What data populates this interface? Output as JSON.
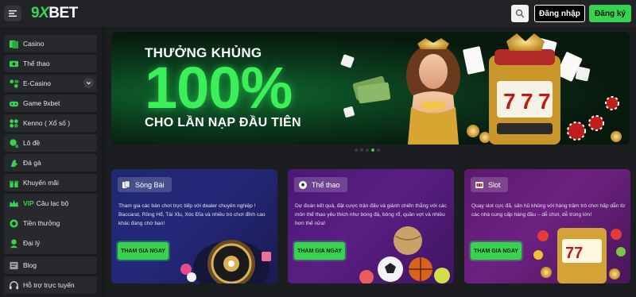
{
  "header": {
    "logo_nine": "9",
    "logo_x": "X",
    "logo_bet": "BET",
    "login_label": "Đăng nhập",
    "register_label": "Đăng ký"
  },
  "sidebar": {
    "items": [
      {
        "label": "Casino",
        "icon": "casino-icon"
      },
      {
        "label": "Thể thao",
        "icon": "sports-icon"
      },
      {
        "label": "E-Casino",
        "icon": "ecasino-icon"
      },
      {
        "label": "Game 9xbet",
        "icon": "gamepad-icon"
      },
      {
        "label": "Kenno ( Xổ số )",
        "icon": "lottery-icon"
      },
      {
        "label": "Lô đề",
        "icon": "lode-icon"
      },
      {
        "label": "Đá gà",
        "icon": "rooster-icon"
      },
      {
        "label": "Khuyến mãi",
        "icon": "gift-icon"
      },
      {
        "label_vip": "VIP",
        "label": "Câu lạc bộ",
        "icon": "crown-icon"
      },
      {
        "label": "Tiền thưởng",
        "icon": "reward-icon"
      },
      {
        "label": "Đại lý",
        "icon": "agent-icon"
      },
      {
        "label": "Blog",
        "icon": "blog-icon"
      },
      {
        "label": "Hỗ trợ trực tuyến",
        "icon": "headset-icon"
      }
    ]
  },
  "banner": {
    "line1": "THƯỞNG KHỦNG",
    "line2": "100%",
    "line3": "CHO LẦN NẠP ĐẦU TIÊN",
    "slide_count": 5,
    "active_slide": 4
  },
  "cards": [
    {
      "title": "Sòng Bài",
      "icon": "cards-icon",
      "description": "Tham gia các bàn chơi trực tiếp với dealer chuyên nghiệp ! Baccarat, Rồng Hổ, Tài Xỉu, Xóc Đĩa và nhiều trò chơi đỉnh cao khác đang chờ bạn!",
      "button": "THAM GIA NGAY"
    },
    {
      "title": "Thể thao",
      "icon": "soccer-ball-icon",
      "description": "Dự đoán kết quả, đặt cược trận đấu và giành chiến thắng với các môn thể thao yêu thích như bóng đá, bóng rổ, quần vợt và nhiều hơn thế nữa!",
      "button": "THAM GIA NGAY"
    },
    {
      "title": "Slot",
      "icon": "slot-icon",
      "description": "Quay slot cực đã, săn hũ khủng với hàng trăm trò chơi hấp dẫn từ các nhà cung cấp hàng đầu – dễ chơi, dễ trúng lớn!",
      "button": "THAM GIA NGAY"
    }
  ],
  "colors": {
    "accent": "#37d24f",
    "background": "#1c1d20",
    "panel": "#28292d"
  }
}
